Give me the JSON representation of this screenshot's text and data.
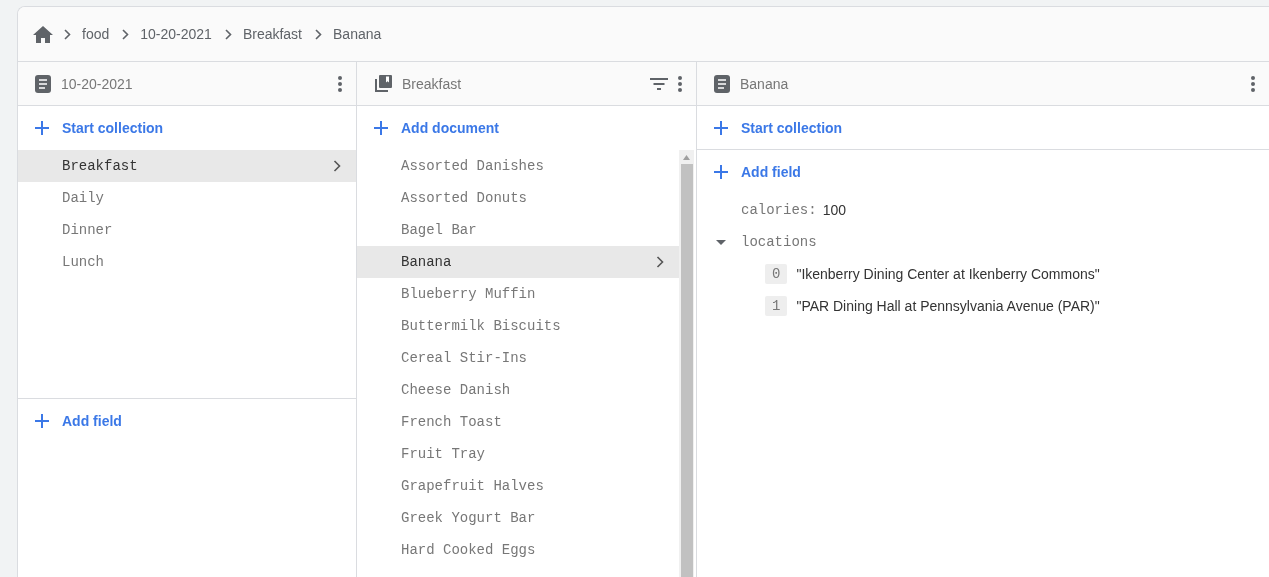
{
  "breadcrumb": [
    "food",
    "10-20-2021",
    "Breakfast",
    "Banana"
  ],
  "panes": [
    {
      "kind": "document",
      "title": "10-20-2021",
      "action": "Start collection",
      "items": [
        {
          "label": "Breakfast",
          "selected": true
        },
        {
          "label": "Daily",
          "selected": false
        },
        {
          "label": "Dinner",
          "selected": false
        },
        {
          "label": "Lunch",
          "selected": false
        }
      ],
      "footer_action": "Add field"
    },
    {
      "kind": "collection",
      "title": "Breakfast",
      "action": "Add document",
      "items": [
        {
          "label": "Assorted Danishes",
          "selected": false
        },
        {
          "label": "Assorted Donuts",
          "selected": false
        },
        {
          "label": "Bagel Bar",
          "selected": false
        },
        {
          "label": "Banana",
          "selected": true
        },
        {
          "label": "Blueberry Muffin",
          "selected": false
        },
        {
          "label": "Buttermilk Biscuits",
          "selected": false
        },
        {
          "label": "Cereal Stir-Ins",
          "selected": false
        },
        {
          "label": "Cheese Danish",
          "selected": false
        },
        {
          "label": "French Toast",
          "selected": false
        },
        {
          "label": "Fruit Tray",
          "selected": false
        },
        {
          "label": "Grapefruit Halves",
          "selected": false
        },
        {
          "label": "Greek Yogurt Bar",
          "selected": false
        },
        {
          "label": "Hard Cooked Eggs",
          "selected": false
        }
      ]
    },
    {
      "kind": "fields",
      "title": "Banana",
      "action": "Start collection",
      "field_action": "Add field",
      "fields": [
        {
          "kind": "scalar",
          "key": "calories:",
          "value": "100"
        },
        {
          "kind": "array",
          "key": "locations",
          "expanded": true,
          "items": [
            {
              "index": "0",
              "value": "\"Ikenberry Dining Center at Ikenberry Commons\""
            },
            {
              "index": "1",
              "value": "\"PAR Dining Hall at Pennsylvania Avenue (PAR)\""
            }
          ]
        }
      ]
    }
  ]
}
